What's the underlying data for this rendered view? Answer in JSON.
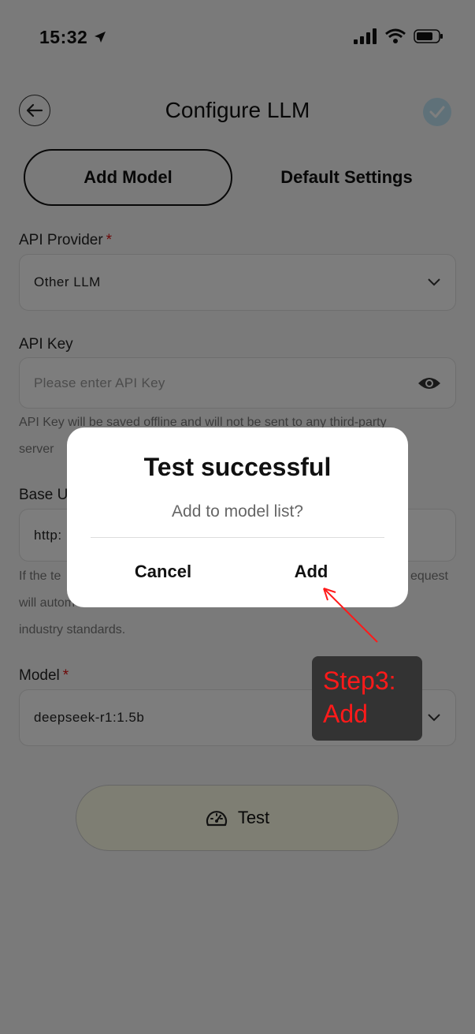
{
  "status_bar": {
    "time": "15:32"
  },
  "header": {
    "title": "Configure LLM"
  },
  "tabs": [
    {
      "label": "Add Model",
      "active": true
    },
    {
      "label": "Default Settings",
      "active": false
    }
  ],
  "form": {
    "provider": {
      "label": "API Provider",
      "required_mark": "*",
      "value": "Other LLM"
    },
    "api_key": {
      "label": "API Key",
      "placeholder": "Please enter API Key",
      "help_line1": "API Key will be saved offline and will not be sent to any third-party",
      "help_line2": "server"
    },
    "base_url": {
      "label": "Base U",
      "value": "http:",
      "help_line1_left": "If the te",
      "help_line1_right": "equest",
      "help_line2": "will autom",
      "help_line3": "industry standards."
    },
    "model": {
      "label": "Model",
      "required_mark": "*",
      "value": "deepseek-r1:1.5b"
    },
    "test_button": {
      "label": "Test"
    }
  },
  "dialog": {
    "title": "Test successful",
    "message": "Add to model list?",
    "cancel_label": "Cancel",
    "add_label": "Add"
  },
  "annotation": {
    "line1": "Step3:",
    "line2": "Add",
    "color": "#ff1a1a"
  },
  "colors": {
    "required": "#d11111",
    "check_bg": "#bfe3f2",
    "test_bg": "#fcfce6"
  }
}
